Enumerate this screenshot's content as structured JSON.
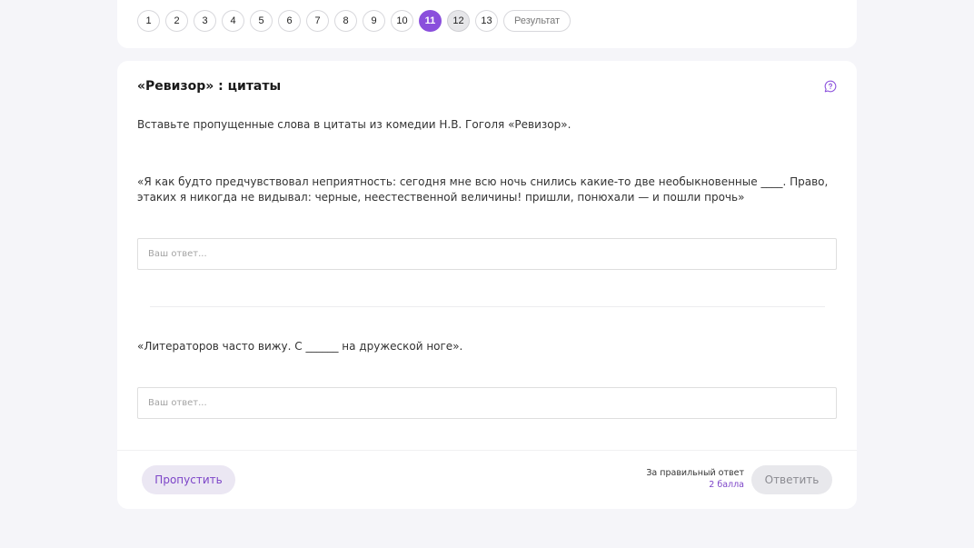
{
  "pager": {
    "pages": [
      "1",
      "2",
      "3",
      "4",
      "5",
      "6",
      "7",
      "8",
      "9",
      "10",
      "11",
      "12",
      "13"
    ],
    "active_page": "11",
    "visited_page": "12",
    "result_label": "Результат"
  },
  "task": {
    "title": "«Ревизор» : цитаты",
    "instruction": "Вставьте пропущенные слова в цитаты из комедии Н.В. Гоголя «Ревизор».",
    "questions": [
      {
        "text": "«Я как будто предчувствовал неприятность: сегодня мне всю ночь снились какие-то две необыкновенные ____. Право, этаких я никогда не видывал: черные, неестественной величины! пришли, понюхали — и пошли прочь»",
        "answer_value": "",
        "answer_placeholder": "Ваш ответ..."
      },
      {
        "text": "«Литераторов часто вижу. С ______ на дружеской ноге».",
        "answer_value": "",
        "answer_placeholder": "Ваш ответ..."
      }
    ]
  },
  "footer": {
    "skip_label": "Пропустить",
    "reward_label": "За правильный ответ",
    "reward_points": "2 балла",
    "answer_label": "Ответить"
  },
  "colors": {
    "accent": "#8a4fdc",
    "background": "#f5f5f9"
  },
  "icons": {
    "comment": "comment-icon"
  }
}
